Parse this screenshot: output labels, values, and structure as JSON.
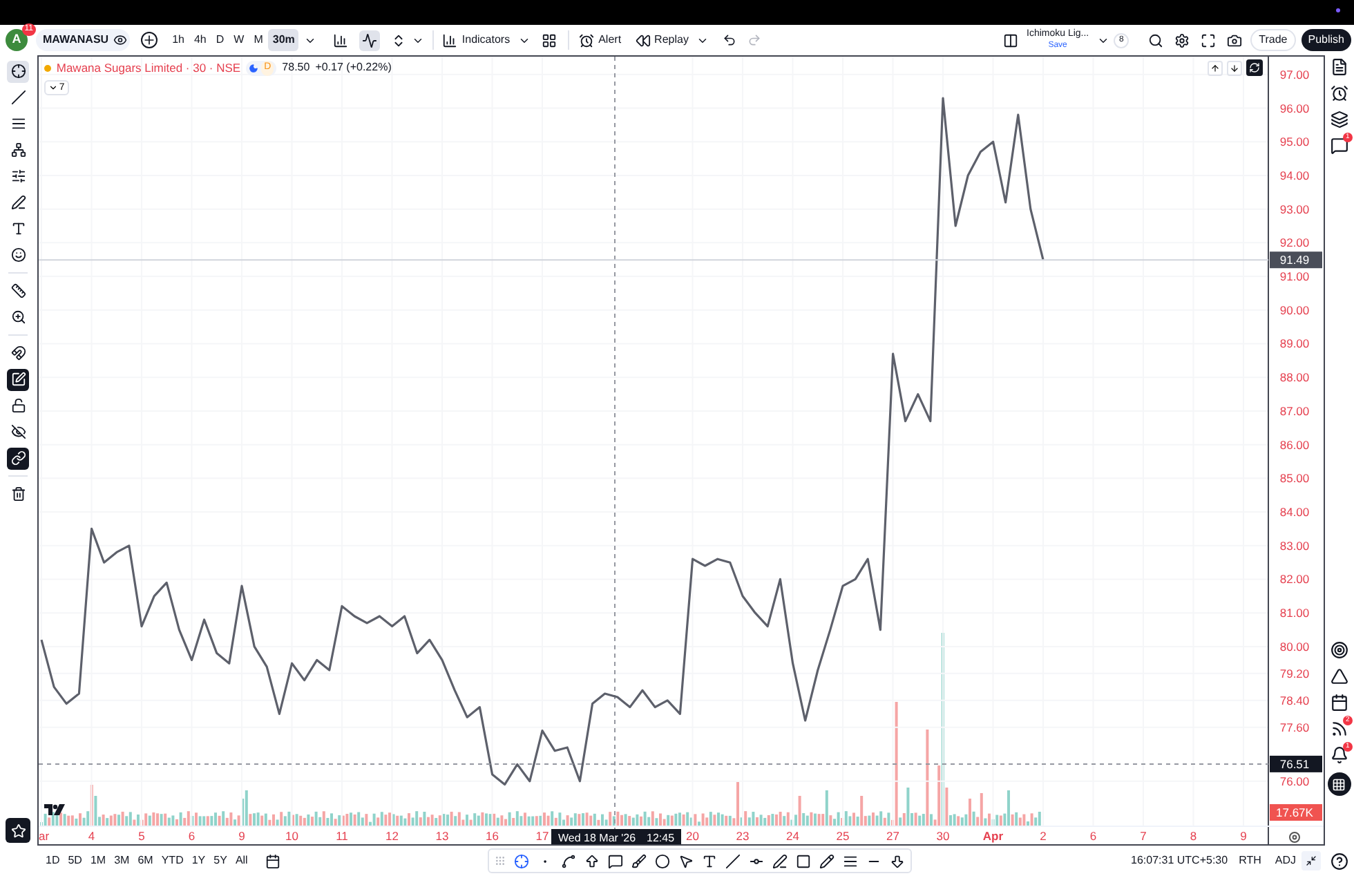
{
  "toolbar": {
    "avatar": "A",
    "avatar_badge": "11",
    "symbol": "MAWANASU",
    "intervals": [
      {
        "label": "1h",
        "selected": false
      },
      {
        "label": "4h",
        "selected": false
      },
      {
        "label": "D",
        "selected": false
      },
      {
        "label": "W",
        "selected": false
      },
      {
        "label": "M",
        "selected": false
      },
      {
        "label": "30m",
        "selected": true
      }
    ],
    "indicators": "Indicators",
    "alert": "Alert",
    "replay": "Replay",
    "layout_name": "Ichimoku Lig...",
    "layout_save": "Save",
    "layout_count": "8",
    "trade": "Trade",
    "publish": "Publish"
  },
  "left_toolbar": [
    {
      "selected": true,
      "on": false
    },
    {
      "selected": false,
      "on": false
    },
    {
      "selected": false,
      "on": false
    },
    {
      "selected": false,
      "on": false
    },
    {
      "selected": false,
      "on": false
    },
    {
      "selected": false,
      "on": false
    },
    {
      "selected": false,
      "on": false
    },
    {
      "selected": false,
      "on": false
    },
    {
      "selected": false,
      "on": false
    },
    {
      "selected": false,
      "on": false
    },
    {
      "selected": false,
      "on": false
    },
    {
      "selected": false,
      "on": true
    },
    {
      "selected": false,
      "on": false
    },
    {
      "selected": false,
      "on": false
    },
    {
      "selected": false,
      "on": true
    },
    {
      "selected": false,
      "on": false
    }
  ],
  "legend": {
    "title": "Mawana Sugars Limited · 30 · NSE",
    "session": "D",
    "price": "78.50",
    "change": "+0.17 (+0.22%)",
    "indicator_count": "7"
  },
  "chart": {
    "price_markers": [
      {
        "label": "91.49",
        "kind": "last"
      },
      {
        "label": "76.51",
        "kind": "crosshair"
      }
    ],
    "volume_label": "17.67K",
    "crosshair_time": "Wed 18 Mar '26",
    "crosshair_clock": "12:45",
    "chart_data": {
      "type": "line",
      "ylim": [
        74.66,
        97.53
      ],
      "grid": true,
      "categories": [
        "ar",
        null,
        null,
        null,
        "4",
        null,
        null,
        null,
        "5",
        null,
        null,
        null,
        "6",
        null,
        null,
        null,
        "9",
        null,
        null,
        null,
        "10",
        null,
        null,
        null,
        "11",
        null,
        null,
        null,
        "12",
        null,
        null,
        null,
        "13",
        null,
        null,
        null,
        "16",
        null,
        null,
        null,
        "17",
        null,
        null,
        null,
        null,
        null,
        null,
        null,
        null,
        null,
        null,
        null,
        "20",
        null,
        null,
        null,
        "23",
        null,
        null,
        null,
        "24",
        null,
        null,
        null,
        "25",
        null,
        null,
        null,
        "27",
        null,
        null,
        null,
        "30",
        null,
        null,
        null,
        "Apr",
        null,
        null,
        null,
        "2",
        null,
        null,
        null,
        "6",
        null,
        null,
        null,
        "7",
        null,
        null,
        null,
        "8",
        null,
        null,
        null,
        "9"
      ],
      "series": [
        {
          "color": "#5d606b",
          "values": [
            80.2,
            78.8,
            78.3,
            78.6,
            83.5,
            82.5,
            82.8,
            83.0,
            80.6,
            81.5,
            81.9,
            80.5,
            79.6,
            80.8,
            79.8,
            79.5,
            81.8,
            80.0,
            79.4,
            78.0,
            79.5,
            79.0,
            79.6,
            79.3,
            81.2,
            80.9,
            80.7,
            80.9,
            80.6,
            80.9,
            79.8,
            80.2,
            79.6,
            78.7,
            77.9,
            78.2,
            76.2,
            75.9,
            76.5,
            76.0,
            77.5,
            76.9,
            77.0,
            76.0,
            78.3,
            78.6,
            78.5,
            78.2,
            78.7,
            78.2,
            78.4,
            78.0,
            82.6,
            82.4,
            82.6,
            82.5,
            81.5,
            81.0,
            80.6,
            82.0,
            79.5,
            77.8,
            79.3,
            80.5,
            81.8,
            82.0,
            82.6,
            80.5,
            88.7,
            86.7,
            87.5,
            86.7,
            96.3,
            92.5,
            94.0,
            94.7,
            95.0,
            93.2,
            95.8,
            93.0,
            91.5,
            null,
            null,
            null,
            null,
            null,
            null,
            null,
            null,
            null,
            null,
            null,
            null,
            null,
            null,
            null,
            null
          ]
        }
      ],
      "yticks": [
        {
          "value": 97,
          "label": "97.00"
        },
        {
          "value": 96,
          "label": "96.00"
        },
        {
          "value": 95,
          "label": "95.00"
        },
        {
          "value": 94,
          "label": "94.00"
        },
        {
          "value": 93,
          "label": "93.00"
        },
        {
          "value": 92,
          "label": "92.00"
        },
        {
          "value": 91,
          "label": "91.00"
        },
        {
          "value": 90,
          "label": "90.00"
        },
        {
          "value": 89,
          "label": "89.00"
        },
        {
          "value": 88,
          "label": "88.00"
        },
        {
          "value": 87,
          "label": "87.00"
        },
        {
          "value": 86,
          "label": "86.00"
        },
        {
          "value": 85,
          "label": "85.00"
        },
        {
          "value": 84,
          "label": "84.00"
        },
        {
          "value": 83,
          "label": "83.00"
        },
        {
          "value": 82,
          "label": "82.00"
        },
        {
          "value": 81,
          "label": "81.00"
        },
        {
          "value": 80,
          "label": "80.00"
        },
        {
          "value": 79.2,
          "label": "79.20"
        },
        {
          "value": 78.4,
          "label": "78.40"
        },
        {
          "value": 77.6,
          "label": "77.60"
        },
        {
          "value": 76,
          "label": "76.00"
        }
      ]
    }
  },
  "right_sidebar": {
    "chat_badge": "1",
    "rss_badge": "2",
    "bell_badge": "1"
  },
  "bottom_bar": {
    "ranges": [
      "1D",
      "5D",
      "1M",
      "3M",
      "6M",
      "YTD",
      "1Y",
      "5Y",
      "All"
    ],
    "drawing_tools": [
      {
        "selected": true
      },
      {
        "selected": false
      },
      {
        "selected": false
      },
      {
        "selected": false
      },
      {
        "selected": false
      },
      {
        "selected": false
      },
      {
        "selected": false
      },
      {
        "selected": false
      },
      {
        "selected": false
      },
      {
        "selected": false
      },
      {
        "selected": false
      },
      {
        "selected": false
      },
      {
        "selected": false
      },
      {
        "selected": false
      },
      {
        "selected": false
      },
      {
        "selected": false
      },
      {
        "selected": false
      }
    ],
    "time": "16:07:31 UTC+5:30",
    "rth": "RTH",
    "adj": "ADJ"
  }
}
